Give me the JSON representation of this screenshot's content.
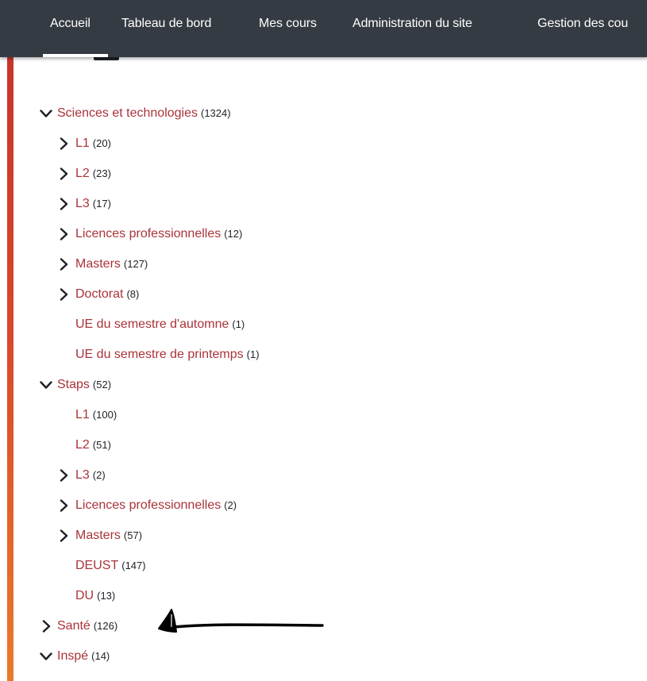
{
  "navbar": {
    "items": [
      {
        "label": "Accueil",
        "active": true
      },
      {
        "label": "Tableau de bord"
      },
      {
        "label": "Mes cours"
      },
      {
        "label": "Administration du site"
      },
      {
        "label": "Gestion des cou"
      }
    ]
  },
  "tree": [
    {
      "label": "Sciences et technologies",
      "count": "(1324)",
      "toggle": "expanded",
      "level": 0
    },
    {
      "label": "L1",
      "count": "(20)",
      "toggle": "collapsed",
      "level": 1
    },
    {
      "label": "L2",
      "count": "(23)",
      "toggle": "collapsed",
      "level": 1
    },
    {
      "label": "L3",
      "count": "(17)",
      "toggle": "collapsed",
      "level": 1
    },
    {
      "label": "Licences professionnelles",
      "count": "(12)",
      "toggle": "collapsed",
      "level": 1
    },
    {
      "label": "Masters",
      "count": "(127)",
      "toggle": "collapsed",
      "level": 1
    },
    {
      "label": "Doctorat",
      "count": "(8)",
      "toggle": "collapsed",
      "level": 1
    },
    {
      "label": "UE du semestre d'automne",
      "count": "(1)",
      "toggle": "none",
      "level": 1
    },
    {
      "label": "UE du semestre de printemps",
      "count": "(1)",
      "toggle": "none",
      "level": 1
    },
    {
      "label": "Staps",
      "count": "(52)",
      "toggle": "expanded",
      "level": 0
    },
    {
      "label": "L1",
      "count": "(100)",
      "toggle": "none",
      "level": 1
    },
    {
      "label": "L2",
      "count": "(51)",
      "toggle": "none",
      "level": 1
    },
    {
      "label": "L3",
      "count": "(2)",
      "toggle": "collapsed",
      "level": 1
    },
    {
      "label": "Licences professionnelles",
      "count": "(2)",
      "toggle": "collapsed",
      "level": 1
    },
    {
      "label": "Masters",
      "count": "(57)",
      "toggle": "collapsed",
      "level": 1
    },
    {
      "label": "DEUST",
      "count": "(147)",
      "toggle": "none",
      "level": 1
    },
    {
      "label": "DU",
      "count": "(13)",
      "toggle": "none",
      "level": 1
    },
    {
      "label": "Santé",
      "count": "(126)",
      "toggle": "collapsed",
      "level": 0
    },
    {
      "label": "Inspé",
      "count": "(14)",
      "toggle": "expanded",
      "level": 0
    }
  ],
  "colors": {
    "navbar_bg": "#353b42",
    "link": "#a9333a",
    "count_text": "#1d2125",
    "accent_top": "#c8352a",
    "accent_bottom": "#ea7a2b"
  },
  "icons": {
    "expanded": "chevron-down-icon",
    "collapsed": "chevron-right-icon",
    "annotation": "hand-drawn-arrow-icon"
  }
}
